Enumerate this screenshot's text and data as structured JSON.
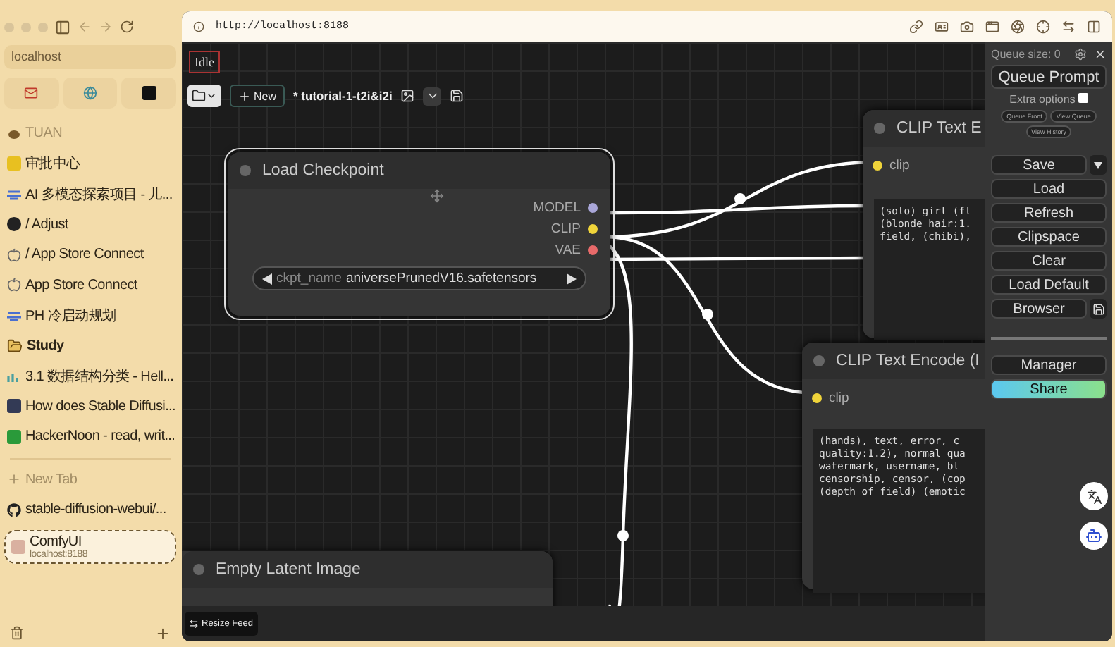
{
  "sidebar": {
    "address": "localhost",
    "items": [
      {
        "label": "TUAN",
        "kind": "section",
        "selected": false
      },
      {
        "label": "审批中心",
        "kind": "tab",
        "selected": false
      },
      {
        "label": "AI 多模态探索项目 - 儿...",
        "kind": "tab",
        "selected": false
      },
      {
        "label": "/ Adjust",
        "kind": "tab",
        "selected": false
      },
      {
        "label": "/ App Store Connect",
        "kind": "tab",
        "selected": false
      },
      {
        "label": "App Store Connect",
        "kind": "tab",
        "selected": false
      },
      {
        "label": "PH 冷启动规划",
        "kind": "tab",
        "selected": false
      },
      {
        "label": "Study",
        "kind": "folder",
        "selected": false
      },
      {
        "label": "3.1  数据结构分类 - Hell...",
        "kind": "tab",
        "selected": false
      },
      {
        "label": "How does Stable Diffusi...",
        "kind": "tab",
        "selected": false
      },
      {
        "label": "HackerNoon - read, writ...",
        "kind": "tab",
        "selected": false
      },
      {
        "label": "New Tab",
        "kind": "new",
        "selected": false
      },
      {
        "label": "stable-diffusion-webui/...",
        "kind": "tab",
        "selected": false
      },
      {
        "label": "ComfyUI",
        "subtitle": "localhost:8188",
        "kind": "tab",
        "selected": true
      }
    ]
  },
  "browser": {
    "url": "http://localhost:8188"
  },
  "canvas": {
    "status": "Idle",
    "new_label": "New",
    "workflow_title": "* tutorial-1-t2i&i2i",
    "load_checkpoint": {
      "title": "Load Checkpoint",
      "outputs": [
        {
          "label": "MODEL",
          "color": "#a9a6d8"
        },
        {
          "label": "CLIP",
          "color": "#f0d43a"
        },
        {
          "label": "VAE",
          "color": "#e86a6a"
        }
      ],
      "widget": {
        "name": "ckpt_name",
        "value": "aniversePrunedV16.safetensors"
      }
    },
    "text_encoders": [
      {
        "title": "CLIP Text E",
        "input": "clip",
        "text": "(solo) girl (fl\n(blonde hair:1.\nfield, (chibi),"
      },
      {
        "title": "CLIP Text Encode (I",
        "input": "clip",
        "text": "(hands), text, error, c\nquality:1.2), normal qua\nwatermark, username, bl\ncensorship, censor, (cop\n(depth of field) (emotic"
      }
    ],
    "empty_latent": {
      "title": "Empty Latent Image"
    },
    "resize_feed": "Resize Feed"
  },
  "queue_panel": {
    "queue_size": "Queue size: 0",
    "queue_prompt": "Queue Prompt",
    "extra_options": {
      "label": "Extra options",
      "checked": false
    },
    "small_buttons": [
      "Queue Front",
      "View Queue",
      "View History"
    ],
    "buttons": [
      {
        "label": "Save",
        "kind": "dropdown"
      },
      {
        "label": "Load",
        "kind": "plain"
      },
      {
        "label": "Refresh",
        "kind": "plain"
      },
      {
        "label": "Clipspace",
        "kind": "plain"
      },
      {
        "label": "Clear",
        "kind": "plain"
      },
      {
        "label": "Load Default",
        "kind": "plain"
      },
      {
        "label": "Browser",
        "kind": "icon"
      }
    ],
    "lower_buttons": [
      {
        "label": "Manager",
        "kind": "plain"
      },
      {
        "label": "Share",
        "kind": "gradient"
      }
    ]
  }
}
